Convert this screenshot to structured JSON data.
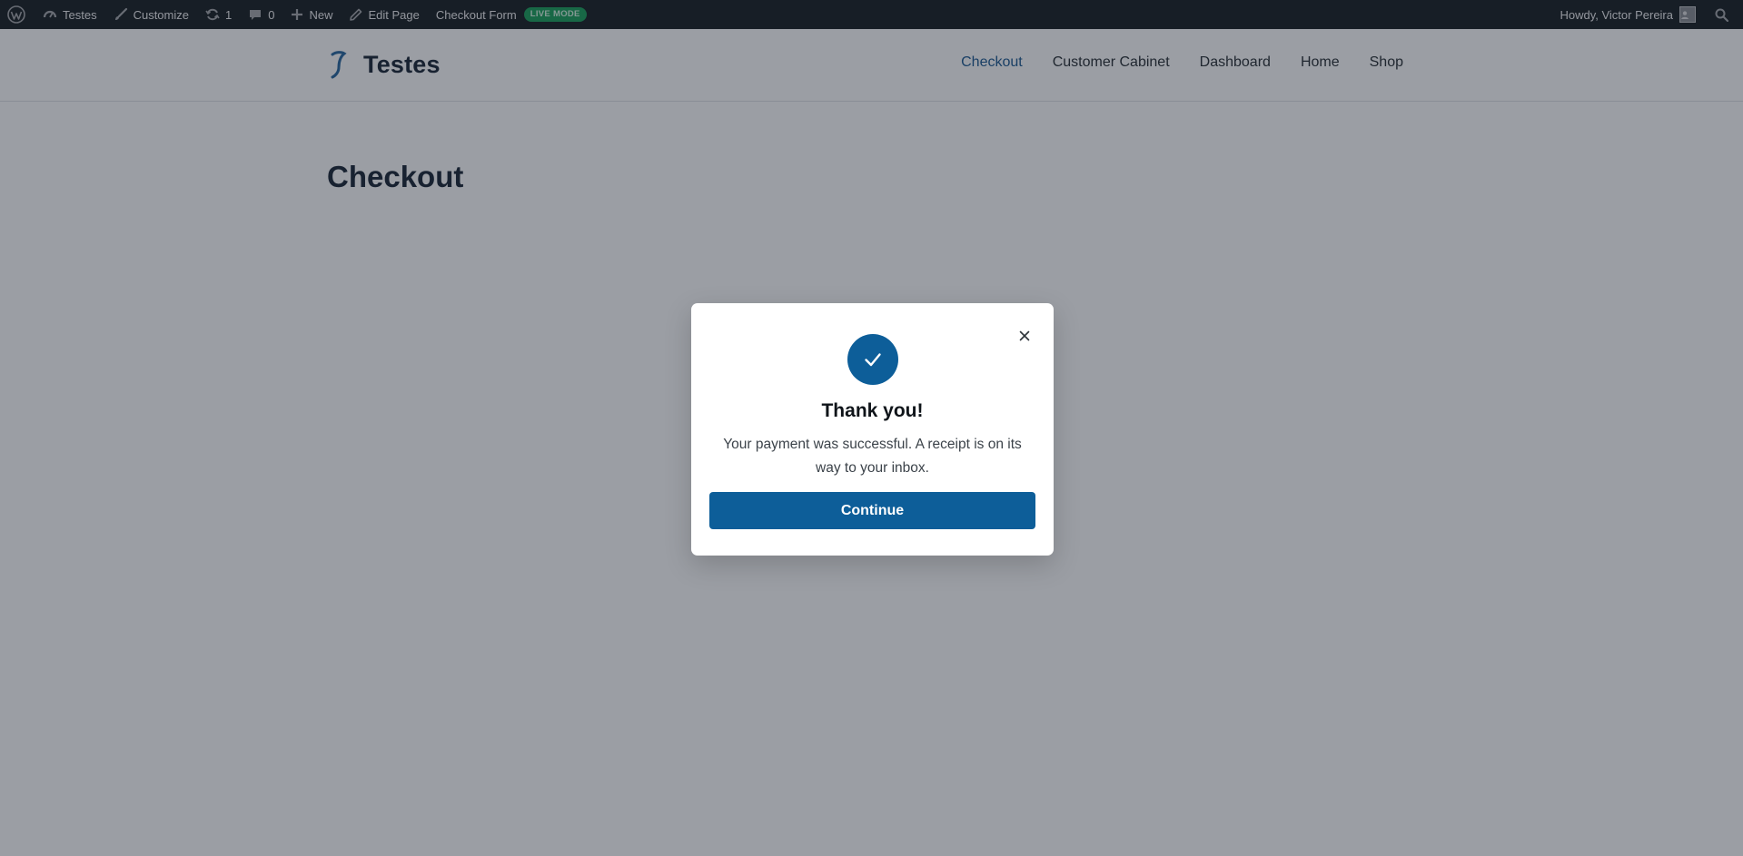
{
  "adminbar": {
    "site_name": "Testes",
    "customize": "Customize",
    "updates_count": "1",
    "comments_count": "0",
    "new_label": "New",
    "edit_page": "Edit Page",
    "checkout_form": "Checkout Form",
    "live_mode": "LIVE MODE",
    "howdy": "Howdy, Victor Pereira"
  },
  "header": {
    "brand": "Testes",
    "nav": [
      "Checkout",
      "Customer Cabinet",
      "Dashboard",
      "Home",
      "Shop"
    ],
    "active_nav": "Checkout"
  },
  "main": {
    "page_title": "Checkout"
  },
  "modal": {
    "title": "Thank you!",
    "message": "Your payment was successful. A receipt is on its way to your inbox.",
    "button": "Continue"
  },
  "colors": {
    "adminbar_bg": "#1d2327",
    "primary": "#0d5e99",
    "live_badge": "#1ea35e",
    "overlay": "rgba(17,24,39,0.42)"
  },
  "icons": {
    "wordpress": "wordpress-icon",
    "dashboard": "dashboard-icon",
    "customize": "brush-icon",
    "updates": "refresh-icon",
    "comments": "comment-icon",
    "new": "plus-icon",
    "edit": "pencil-icon",
    "search": "search-icon",
    "close": "close-icon",
    "success": "check-icon"
  }
}
